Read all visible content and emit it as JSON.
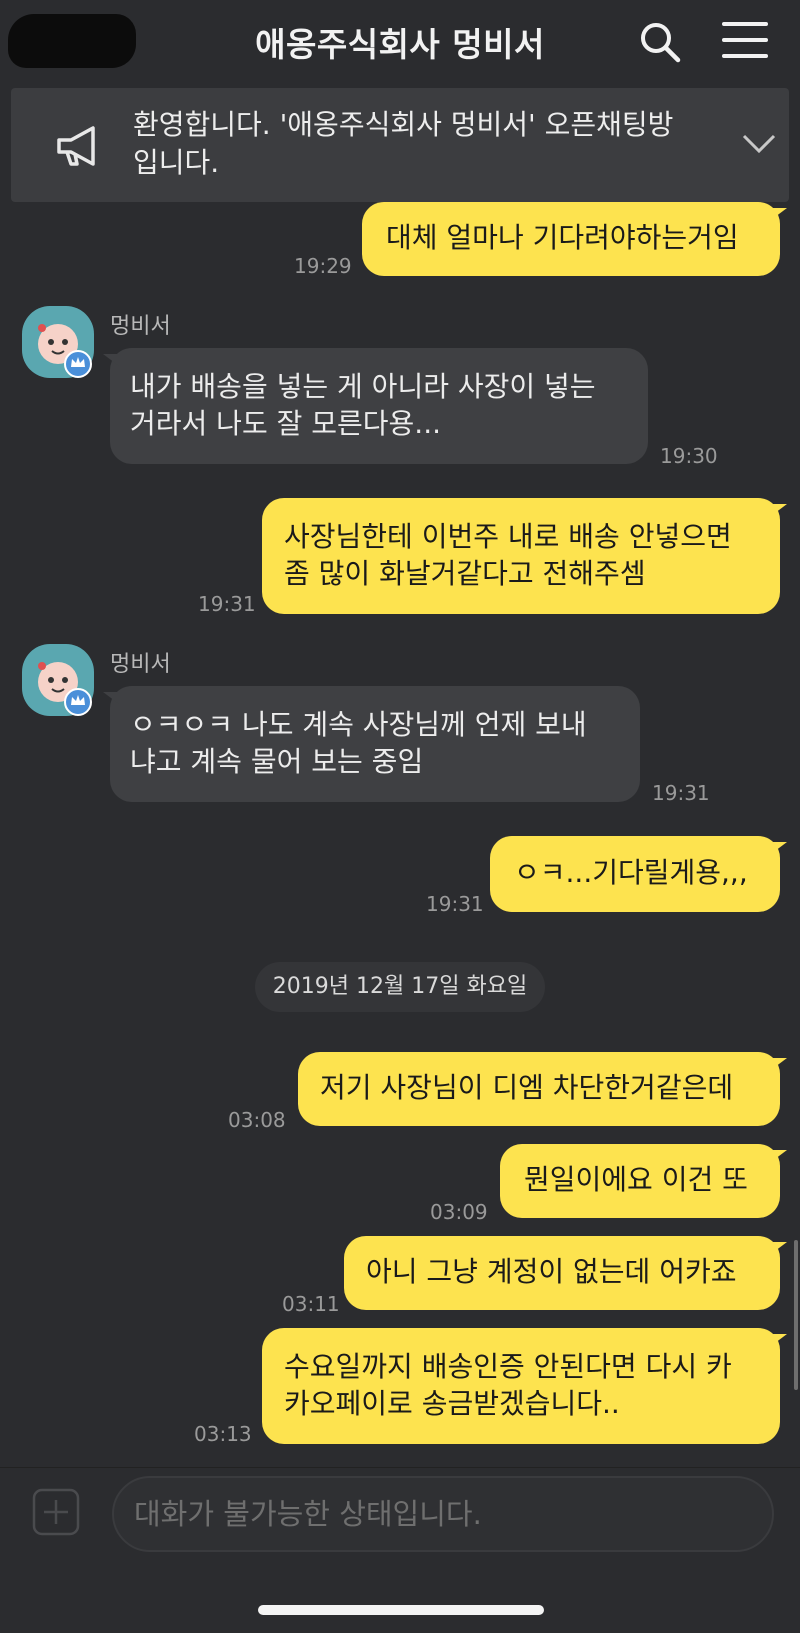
{
  "header": {
    "title": "애옹주식회사 멍비서",
    "search_icon": "search-icon",
    "menu_icon": "hamburger-menu-icon"
  },
  "notice": {
    "text": "환영합니다. '애옹주식회사 멍비서' 오픈채팅방 입니다.",
    "line1": "환영합니다. '애옹주식회사 멍비서' 오픈채팅방",
    "line2": "입니다.",
    "icon": "megaphone-icon",
    "expand_icon": "chevron-down-icon"
  },
  "messages": [
    {
      "from": "me",
      "lines": [
        "대체 얼마나 기다려야하는거임"
      ],
      "time": "19:29"
    },
    {
      "from": "other",
      "sender": "멍비서",
      "lines": [
        "내가 배송을 넣는 게 아니라 사장이 넣는",
        "거라서 나도 잘 모른다용..."
      ],
      "time": "19:30"
    },
    {
      "from": "me",
      "lines": [
        "사장님한테 이번주 내로 배송 안넣으면",
        "좀 많이 화날거같다고 전해주셈"
      ],
      "time": "19:31"
    },
    {
      "from": "other",
      "sender": "멍비서",
      "lines": [
        "ㅇㅋㅇㅋ 나도 계속 사장님께 언제 보내",
        "냐고 계속 물어 보는 중임"
      ],
      "time": "19:31"
    },
    {
      "from": "me",
      "lines": [
        "ㅇㅋ...기다릴게용,,,"
      ],
      "time": "19:31"
    },
    {
      "from": "me",
      "lines": [
        "저기 사장님이 디엠 차단한거같은데"
      ],
      "time": "03:08"
    },
    {
      "from": "me",
      "lines": [
        "뭔일이에요 이건 또"
      ],
      "time": "03:09"
    },
    {
      "from": "me",
      "lines": [
        "아니 그냥 계정이 없는데 어카죠"
      ],
      "time": "03:11"
    },
    {
      "from": "me",
      "lines": [
        "수요일까지 배송인증 안된다면 다시 카",
        "카오페이로 송금받겠습니다.."
      ],
      "time": "03:13"
    }
  ],
  "date_divider": "2019년 12월 17일 화요일",
  "input": {
    "placeholder": "대화가 불가능한 상태입니다.",
    "plus_icon": "plus-icon"
  },
  "colors": {
    "background": "#2b2c2f",
    "my_bubble": "#fde34f",
    "their_bubble": "#3f4043",
    "notice_bg": "#3c3d40"
  }
}
